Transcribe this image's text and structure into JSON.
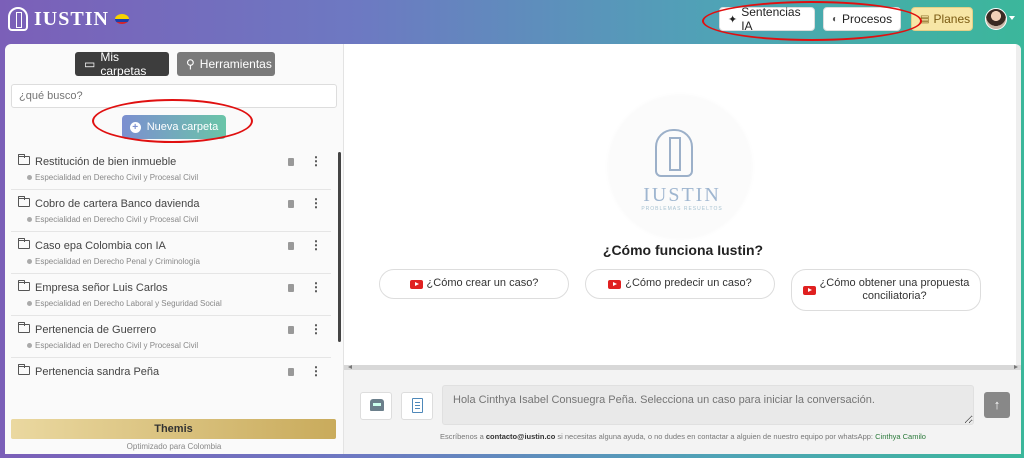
{
  "header": {
    "brand": "IUSTIN",
    "buttons": {
      "sentencias": "Sentencias IA",
      "procesos": "Procesos",
      "planes": "Planes"
    },
    "colors": {
      "highlight_ellipse": "#e01010",
      "planes_bg": "#f7e6a6"
    }
  },
  "sidebar": {
    "tabs": [
      "Mis carpetas",
      "Herramientas"
    ],
    "search_placeholder": "¿qué busco?",
    "new_folder_label": "Nueva carpeta",
    "folders": [
      {
        "title": "Restitución de bien inmueble",
        "subtitle": "Especialidad en Derecho Civil y Procesal Civil"
      },
      {
        "title": "Cobro de cartera Banco davienda",
        "subtitle": "Especialidad en Derecho Civil y Procesal Civil"
      },
      {
        "title": "Caso epa Colombia con IA",
        "subtitle": "Especialidad en Derecho Penal y Criminología"
      },
      {
        "title": "Empresa señor Luis Carlos",
        "subtitle": "Especialidad en Derecho Laboral y Seguridad Social"
      },
      {
        "title": "Pertenencia de Guerrero",
        "subtitle": "Especialidad en Derecho Civil y Procesal Civil"
      },
      {
        "title": "Pertenencia sandra Peña",
        "subtitle": ""
      }
    ],
    "footer_bar": "Themis",
    "footer_note": "Optimizado para Colombia"
  },
  "main": {
    "logo_text": "IUSTIN",
    "logo_tagline": "PROBLEMAS RESUELTOS",
    "how_title": "¿Cómo funciona Iustin?",
    "video_buttons": [
      "¿Cómo crear un caso?",
      "¿Cómo predecir un caso?",
      "¿Cómo obtener una propuesta conciliatoria?"
    ],
    "chat_placeholder": "Hola Cinthya Isabel Consuegra Peña. Selecciona un caso para iniciar la conversación.",
    "contact_prefix": "Escríbenos a",
    "contact_email": "contacto@iustin.co",
    "contact_suffix": "si necesitas alguna ayuda, o no dudes en contactar a alguien de nuestro equipo por whatsApp:",
    "contact_names": [
      "Cinthya",
      "Camilo"
    ]
  }
}
